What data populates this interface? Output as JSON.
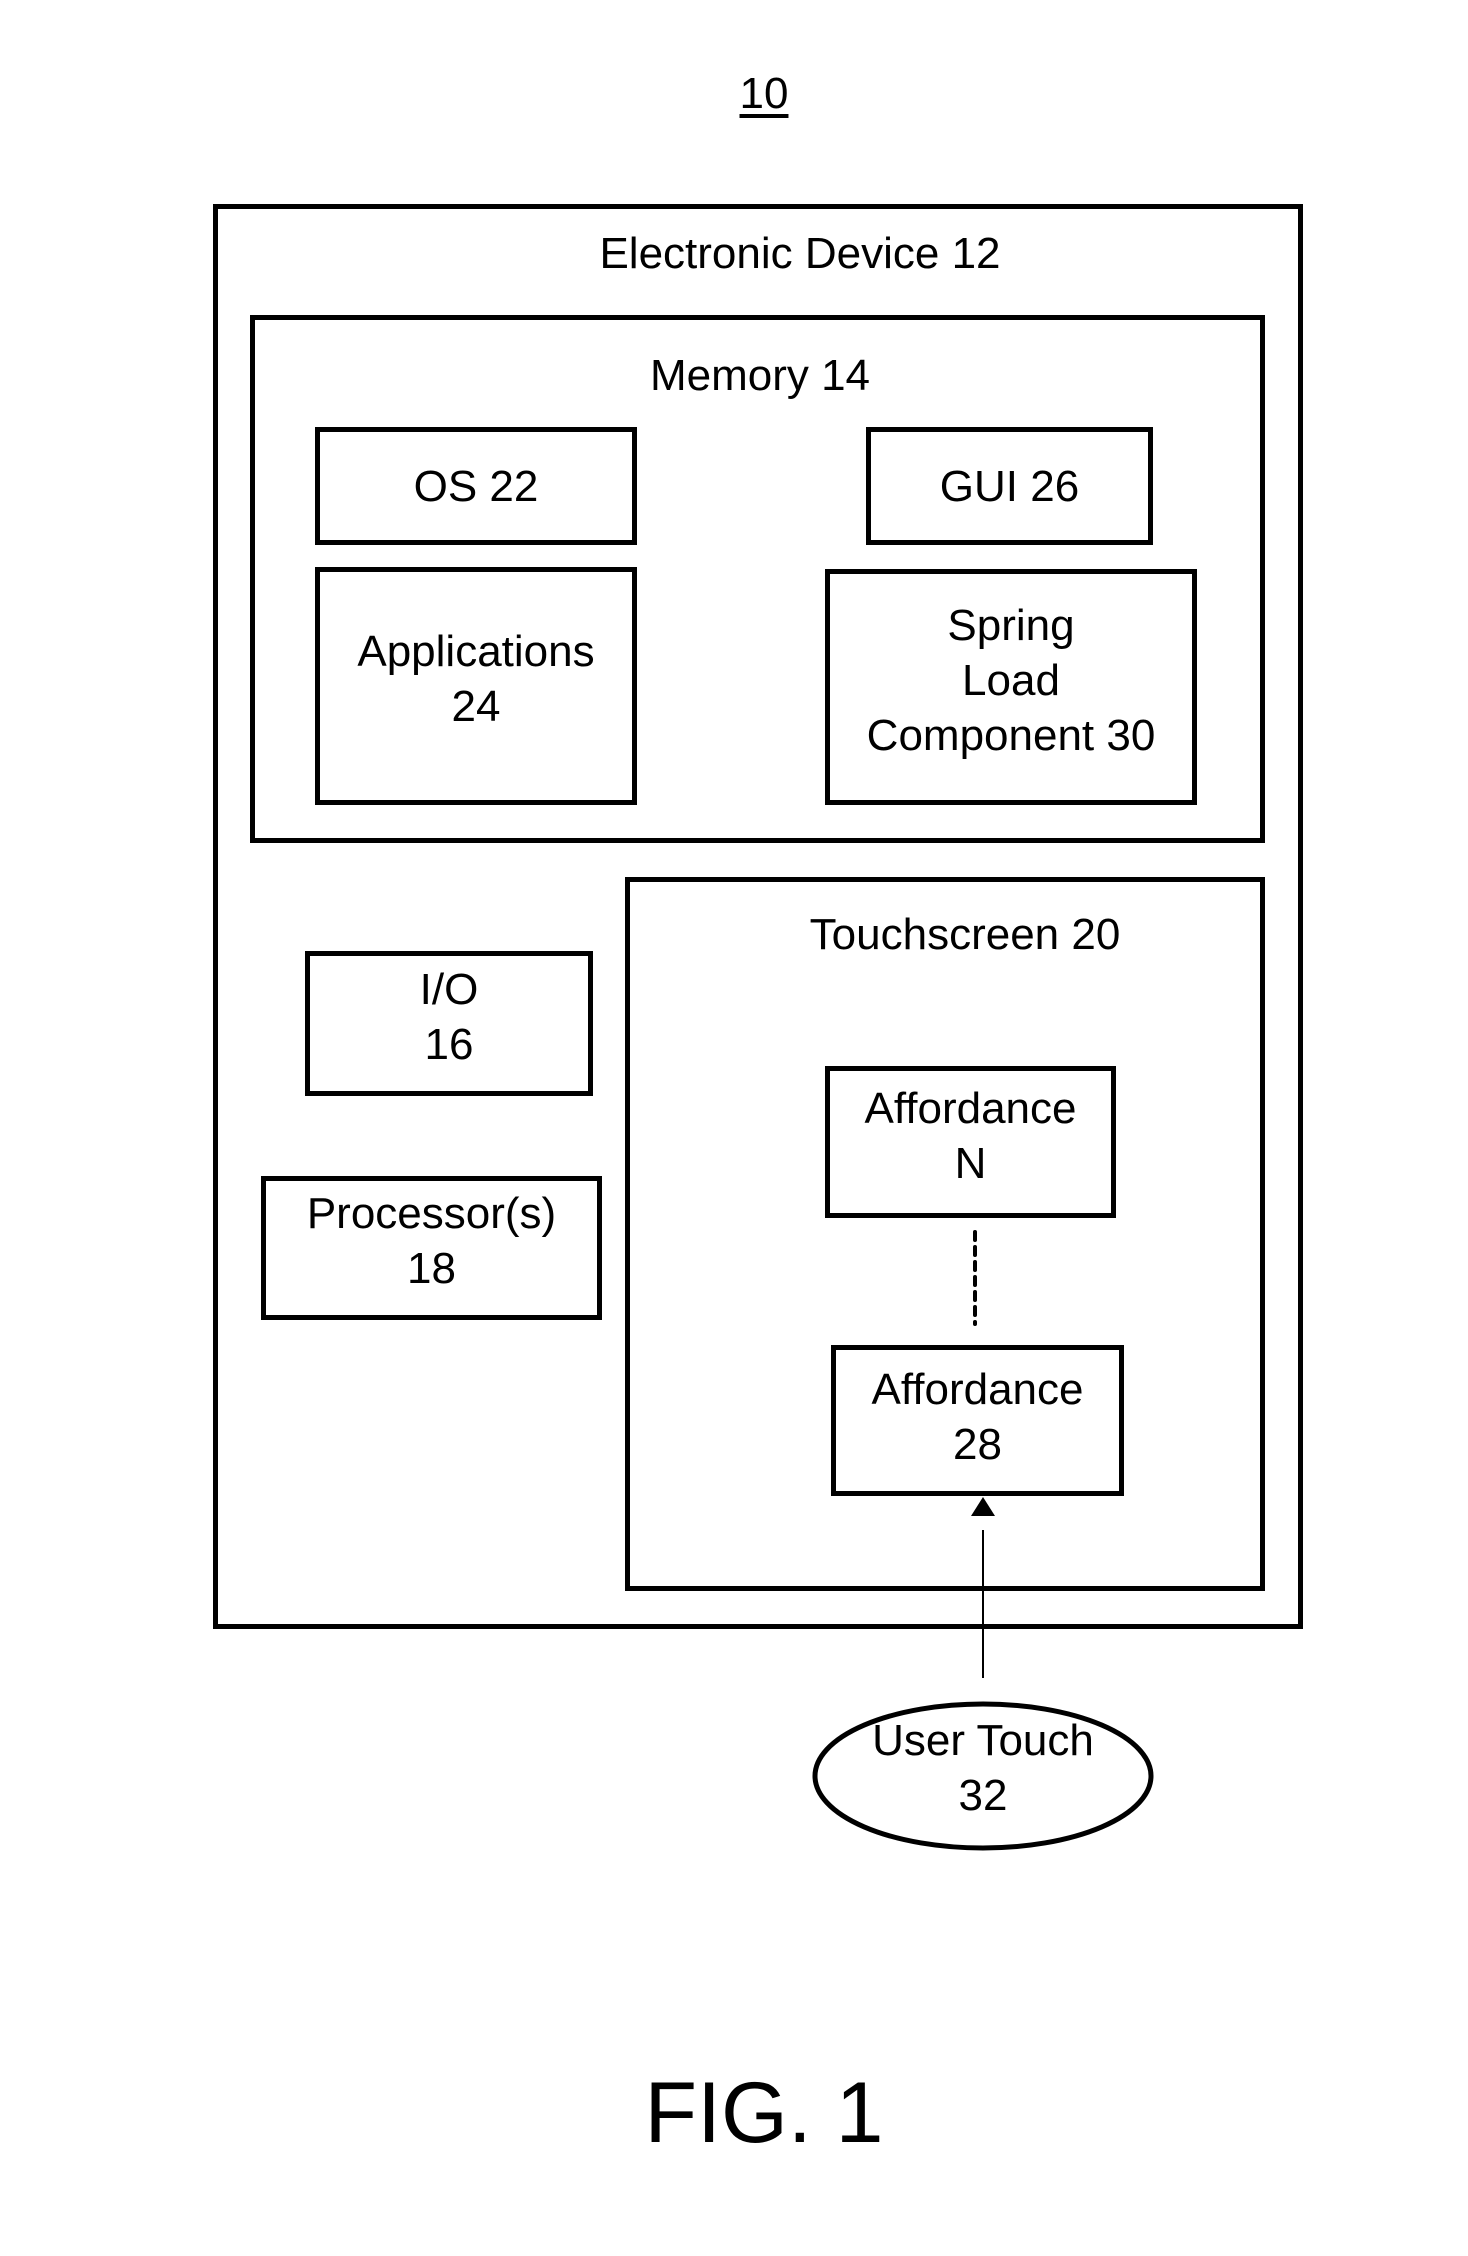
{
  "figure": {
    "reference_number": "10",
    "caption": "FIG. 1"
  },
  "device": {
    "label": "Electronic Device 12"
  },
  "memory": {
    "label": "Memory 14",
    "os": "OS 22",
    "gui": "GUI  26",
    "applications": "Applications\n24",
    "spring_load": "Spring\nLoad\nComponent 30"
  },
  "io": {
    "label": "I/O\n16"
  },
  "processor": {
    "label": "Processor(s)\n18"
  },
  "touchscreen": {
    "label": "Touchscreen 20",
    "affordance_n": "Affordance\nN",
    "affordance_28": "Affordance\n28"
  },
  "user_touch": {
    "label": "User Touch\n32"
  }
}
